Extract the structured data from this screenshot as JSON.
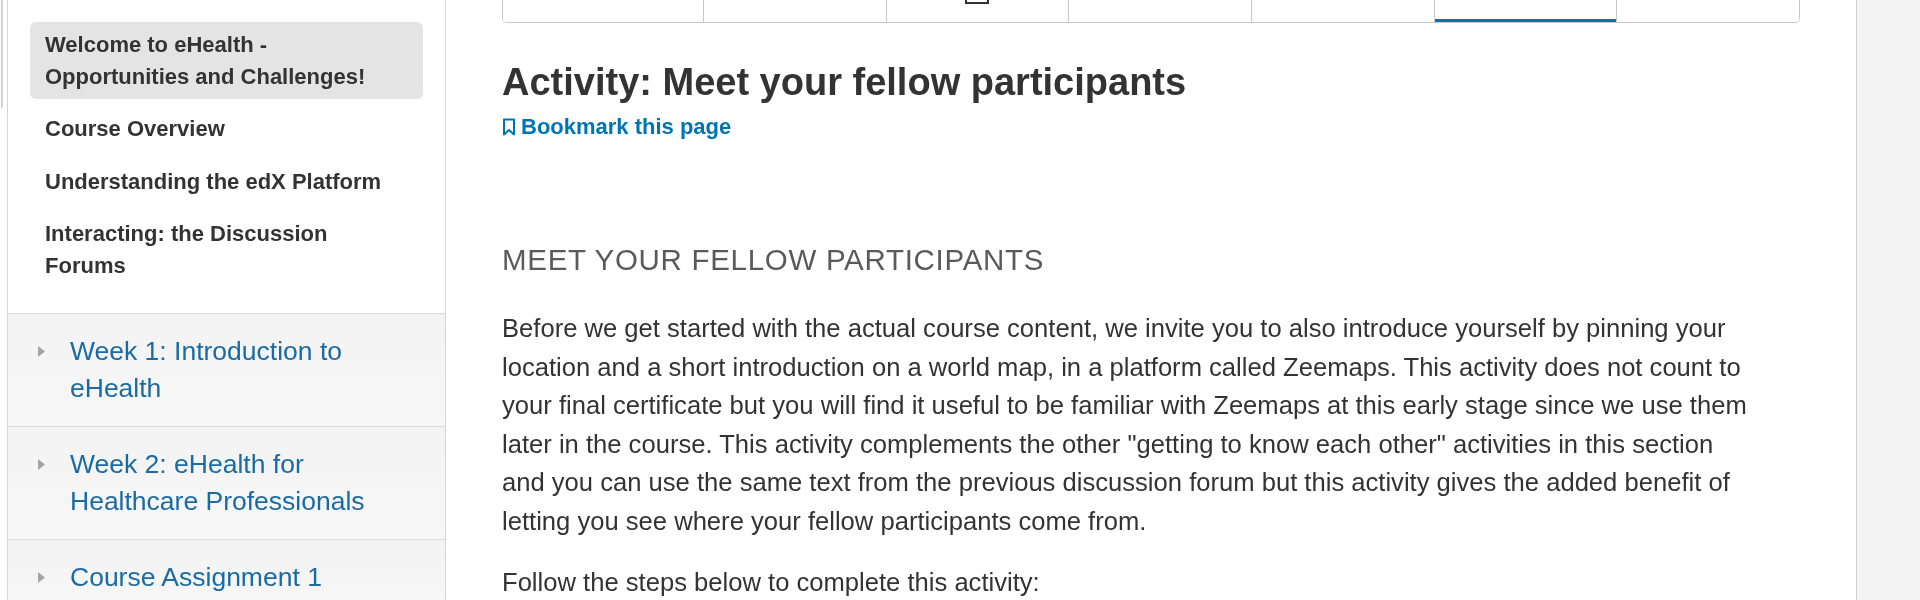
{
  "sidebar": {
    "items": [
      {
        "label": "Welcome to eHealth - Opportunities and Challenges!",
        "selected": true
      },
      {
        "label": "Course Overview",
        "selected": false
      },
      {
        "label": "Understanding the edX Platform",
        "selected": false
      },
      {
        "label": "Interacting: the Discussion Forums",
        "selected": false
      }
    ],
    "sections": [
      {
        "label": "Week 1: Introduction to eHealth",
        "expanded": false
      },
      {
        "label": "Week 2: eHealth for Healthcare Professionals",
        "expanded": false
      },
      {
        "label": "Course Assignment 1",
        "expanded": false
      }
    ]
  },
  "unit_tabs": [
    {
      "kind": "plain",
      "selected": false
    },
    {
      "kind": "plain",
      "selected": false
    },
    {
      "kind": "icon",
      "selected": false
    },
    {
      "kind": "plain",
      "selected": false
    },
    {
      "kind": "plain",
      "selected": false
    },
    {
      "kind": "plain",
      "selected": true
    },
    {
      "kind": "plain",
      "selected": false
    }
  ],
  "page": {
    "title": "Activity: Meet your fellow participants",
    "bookmark": "Bookmark this page",
    "section_heading": "MEET YOUR FELLOW PARTICIPANTS",
    "paragraphs": [
      "Before we get started with the actual course content, we invite you to also introduce yourself by pinning your location and a short introduction on a world map, in a platform called Zeemaps. This activity does not count to your final certificate but you will find it useful to be familiar with Zeemaps at this early stage since we use them later in the course. This activity complements the other \"getting to know each other\" activities in this section and you can use the same text from the previous discussion forum but this activity gives the added benefit of letting you see where your fellow participants come from.",
      "Follow the steps below to complete this activity:"
    ]
  }
}
